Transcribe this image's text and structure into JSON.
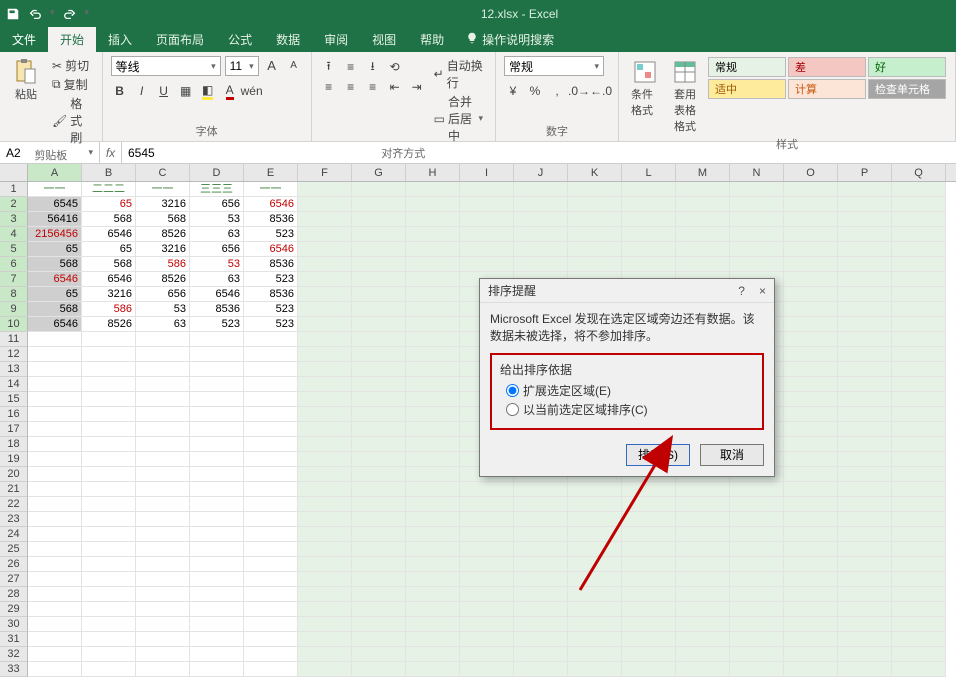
{
  "app": {
    "title": "12.xlsx - Excel",
    "qat": {
      "save": "save-icon",
      "undo": "undo-icon",
      "redo": "redo-icon"
    }
  },
  "colors": {
    "accent": "#1f7246",
    "annotation": "#c00000"
  },
  "tabs": {
    "file": "文件",
    "home": "开始",
    "insert": "插入",
    "layout": "页面布局",
    "formulas": "公式",
    "data": "数据",
    "review": "审阅",
    "view": "视图",
    "help": "帮助",
    "tellme": "操作说明搜索"
  },
  "ribbon": {
    "clipboard": {
      "label": "剪贴板",
      "paste": "粘贴",
      "cut": "剪切",
      "copy": "复制",
      "painter": "格式刷"
    },
    "font": {
      "label": "字体",
      "name": "等线",
      "size": "11",
      "bold": "B",
      "italic": "I",
      "underline": "U",
      "inc": "A",
      "dec": "A"
    },
    "align": {
      "label": "对齐方式",
      "wrap": "自动换行",
      "merge": "合并后居中"
    },
    "number": {
      "label": "数字",
      "format": "常规"
    },
    "styles_group": {
      "label": "样式",
      "cond": "条件格式",
      "table": "套用\n表格格式"
    },
    "styles": {
      "normal": "常规",
      "bad": "差",
      "good": "好",
      "neutral": "适中",
      "calc": "计算",
      "check": "检查单元格"
    }
  },
  "namebox": "A2",
  "formula": "6545",
  "columns": [
    "A",
    "B",
    "C",
    "D",
    "E",
    "F",
    "G",
    "H",
    "I",
    "J",
    "K",
    "L",
    "M",
    "N",
    "O",
    "P",
    "Q"
  ],
  "grid": {
    "r1": {
      "A": "一一",
      "B": "二二二",
      "C": "一一",
      "D": "三三三",
      "E": "一一"
    },
    "r2": {
      "A": "6545",
      "B": "65",
      "C": "3216",
      "D": "656",
      "E": "6546"
    },
    "r3": {
      "A": "56416",
      "B": "568",
      "C": "568",
      "D": "53",
      "E": "8536"
    },
    "r4": {
      "A": "2156456",
      "B": "6546",
      "C": "8526",
      "D": "63",
      "E": "523"
    },
    "r5": {
      "A": "65",
      "B": "65",
      "C": "3216",
      "D": "656",
      "E": "6546"
    },
    "r6": {
      "A": "568",
      "B": "568",
      "C": "586",
      "D": "53",
      "E": "8536"
    },
    "r7": {
      "A": "6546",
      "B": "6546",
      "C": "8526",
      "D": "63",
      "E": "523"
    },
    "r8": {
      "A": "65",
      "B": "3216",
      "C": "656",
      "D": "6546",
      "E": "8536"
    },
    "r9": {
      "A": "568",
      "B": "586",
      "C": "53",
      "D": "8536",
      "E": "523"
    },
    "r10": {
      "A": "6546",
      "B": "8526",
      "C": "63",
      "D": "523",
      "E": "523"
    }
  },
  "red_cells": [
    "r2.B",
    "r2.E",
    "r4.A",
    "r5.E",
    "r6.C",
    "r6.D",
    "r7.A",
    "r9.B"
  ],
  "dialog": {
    "title": "排序提醒",
    "message": "Microsoft Excel 发现在选定区域旁边还有数据。该数据未被选择，将不参加排序。",
    "group_title": "给出排序依据",
    "opt_expand": "扩展选定区域(E)",
    "opt_current": "以当前选定区域排序(C)",
    "selected": "expand",
    "btn_sort": "排序(S)",
    "btn_cancel": "取消",
    "help": "?",
    "close": "×"
  }
}
